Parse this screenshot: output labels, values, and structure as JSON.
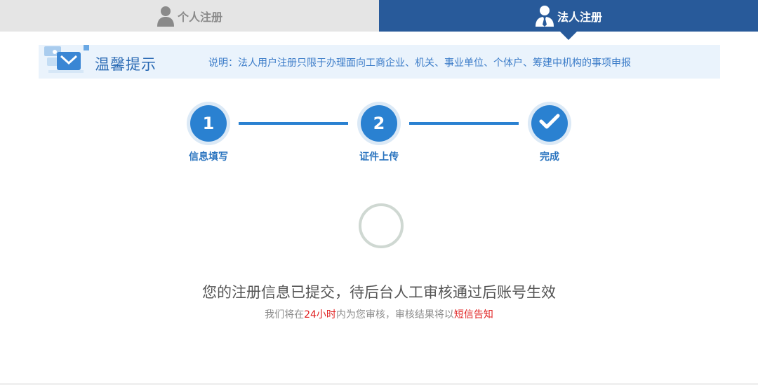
{
  "tabs": {
    "personal": {
      "label": "个人注册",
      "icon": "person-icon",
      "active": false
    },
    "legal": {
      "label": "法人注册",
      "icon": "business-person-icon",
      "active": true
    }
  },
  "tip": {
    "title": "温馨提示",
    "text": "说明：法人用户注册只限于办理面向工商企业、机关、事业单位、个体户、筹建中机构的事项申报",
    "icon": "tip-illustration-icon"
  },
  "steps": [
    {
      "number": "1",
      "label": "信息填写",
      "state": "completed"
    },
    {
      "number": "2",
      "label": "证件上传",
      "state": "completed"
    },
    {
      "number": "",
      "label": "完成",
      "state": "current",
      "icon": "check-icon"
    }
  ],
  "status": {
    "main_message": "您的注册信息已提交，待后台人工审核通过后账号生效",
    "sub_prefix": "我们将在",
    "sub_time": "24小时",
    "sub_middle": "内为您审核，审核结果将以",
    "sub_method": "短信告知"
  },
  "colors": {
    "active_tab": "#285a9a",
    "inactive_tab": "#e5e5e5",
    "step_blue": "#2a81d1",
    "highlight_red": "#e02020",
    "tip_background": "#eaf3fc"
  }
}
